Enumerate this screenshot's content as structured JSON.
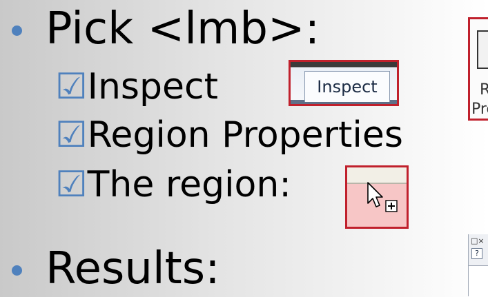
{
  "slide": {
    "line1": "Pick <lmb>:",
    "check_mark": "☑",
    "item_inspect": "Inspect",
    "item_region_props": "Region Properties",
    "item_region": "The region:",
    "line_results": "Results:"
  },
  "callouts": {
    "inspect_tab_label": "Inspect",
    "ribbon_label_top": "R",
    "ribbon_label_bottom": "Pro",
    "dialog_close": "□×",
    "dialog_help": "?"
  },
  "colors": {
    "bullet": "#4f81bd",
    "checkbox": "#4f81bd",
    "highlight_border": "#c0202c",
    "region_fill": "#f7c6c6"
  }
}
